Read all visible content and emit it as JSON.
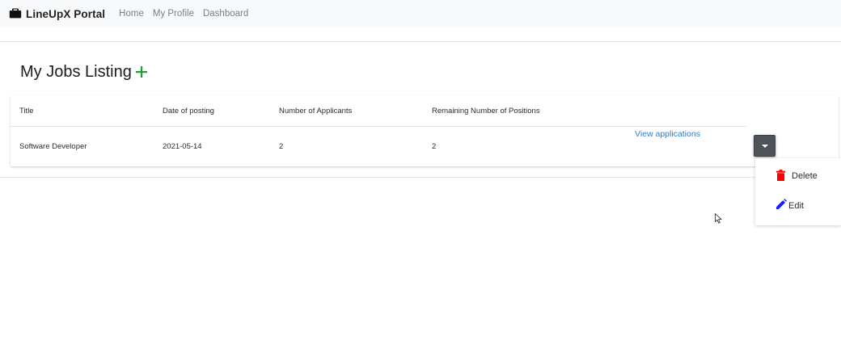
{
  "navbar": {
    "brand": "LineUpX Portal",
    "brand_icon": "briefcase-icon",
    "links": [
      "Home",
      "My Profile",
      "Dashboard"
    ]
  },
  "page": {
    "title": "My Jobs Listing",
    "add_icon": "plus-icon"
  },
  "table": {
    "headers": [
      "Title",
      "Date of posting",
      "Number of Applicants",
      "Remaining Number of Positions"
    ],
    "rows": [
      {
        "title": "Software Developer",
        "date": "2021-05-14",
        "applicants": "2",
        "remaining": "2",
        "action_link": "View applications"
      }
    ]
  },
  "dropdown": {
    "toggle_icon": "caret-down-icon",
    "items": [
      {
        "label": "Delete",
        "icon": "trash-icon",
        "color": "#ff0000"
      },
      {
        "label": "Edit",
        "icon": "pencil-icon",
        "color": "#1a1aff"
      }
    ]
  },
  "colors": {
    "accent_link": "#2b7fd0",
    "add_icon": "#1e9e3a",
    "navbar_bg": "#f8f9fa",
    "toggle_bg": "#4e5358"
  }
}
